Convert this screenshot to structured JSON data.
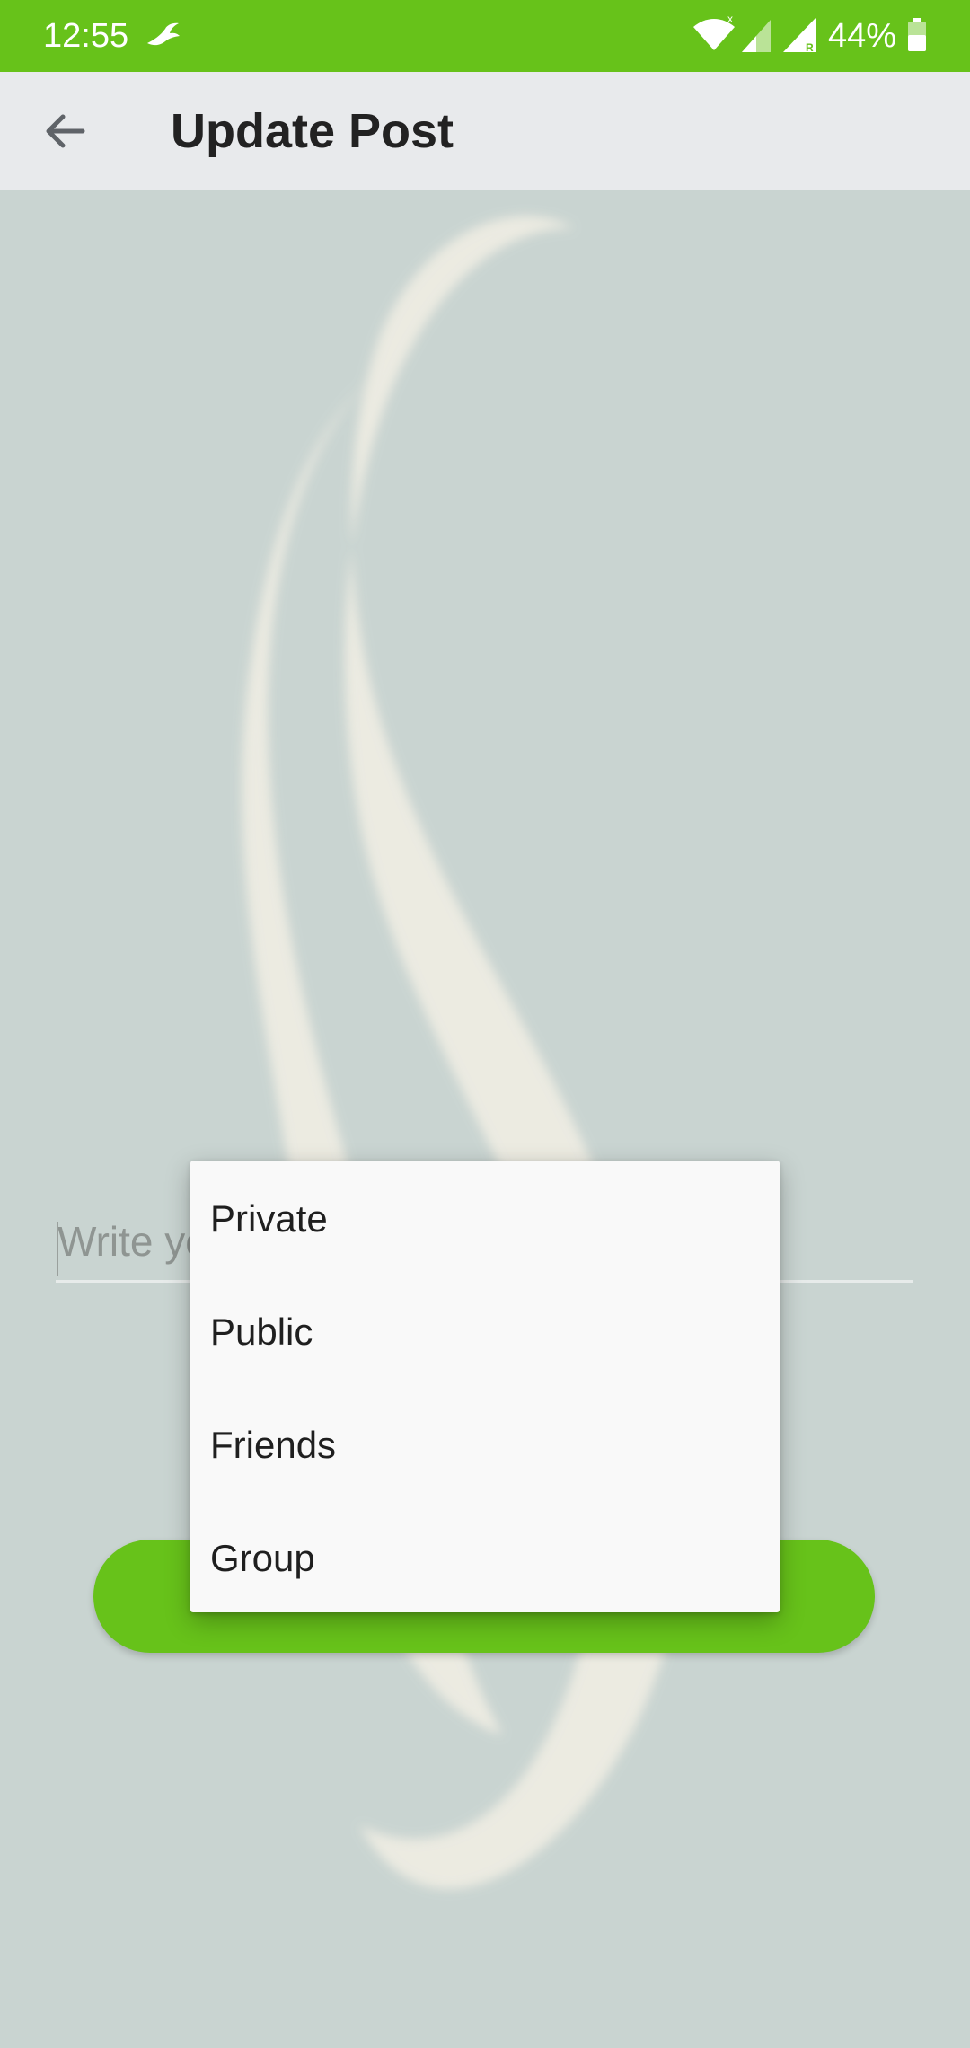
{
  "status_bar": {
    "time": "12:55",
    "battery": "44%",
    "background_color": "#67c21a",
    "icons": [
      "bird-icon",
      "wifi-icon",
      "signal-icon",
      "signal-roaming-icon",
      "battery-icon"
    ]
  },
  "app_bar": {
    "title": "Update Post",
    "back_icon": "arrow-back-icon"
  },
  "post_input": {
    "placeholder": "Write your thoughts here...",
    "value": ""
  },
  "privacy_menu": {
    "items": [
      {
        "label": "Private"
      },
      {
        "label": "Public"
      },
      {
        "label": "Friends"
      },
      {
        "label": "Group"
      }
    ]
  },
  "submit": {
    "label": "",
    "color": "#67c21a"
  },
  "colors": {
    "accent": "#67c21a",
    "app_bar_bg": "#e8eaec",
    "content_bg": "#c9d4d1",
    "menu_bg": "#f9f9f9"
  }
}
